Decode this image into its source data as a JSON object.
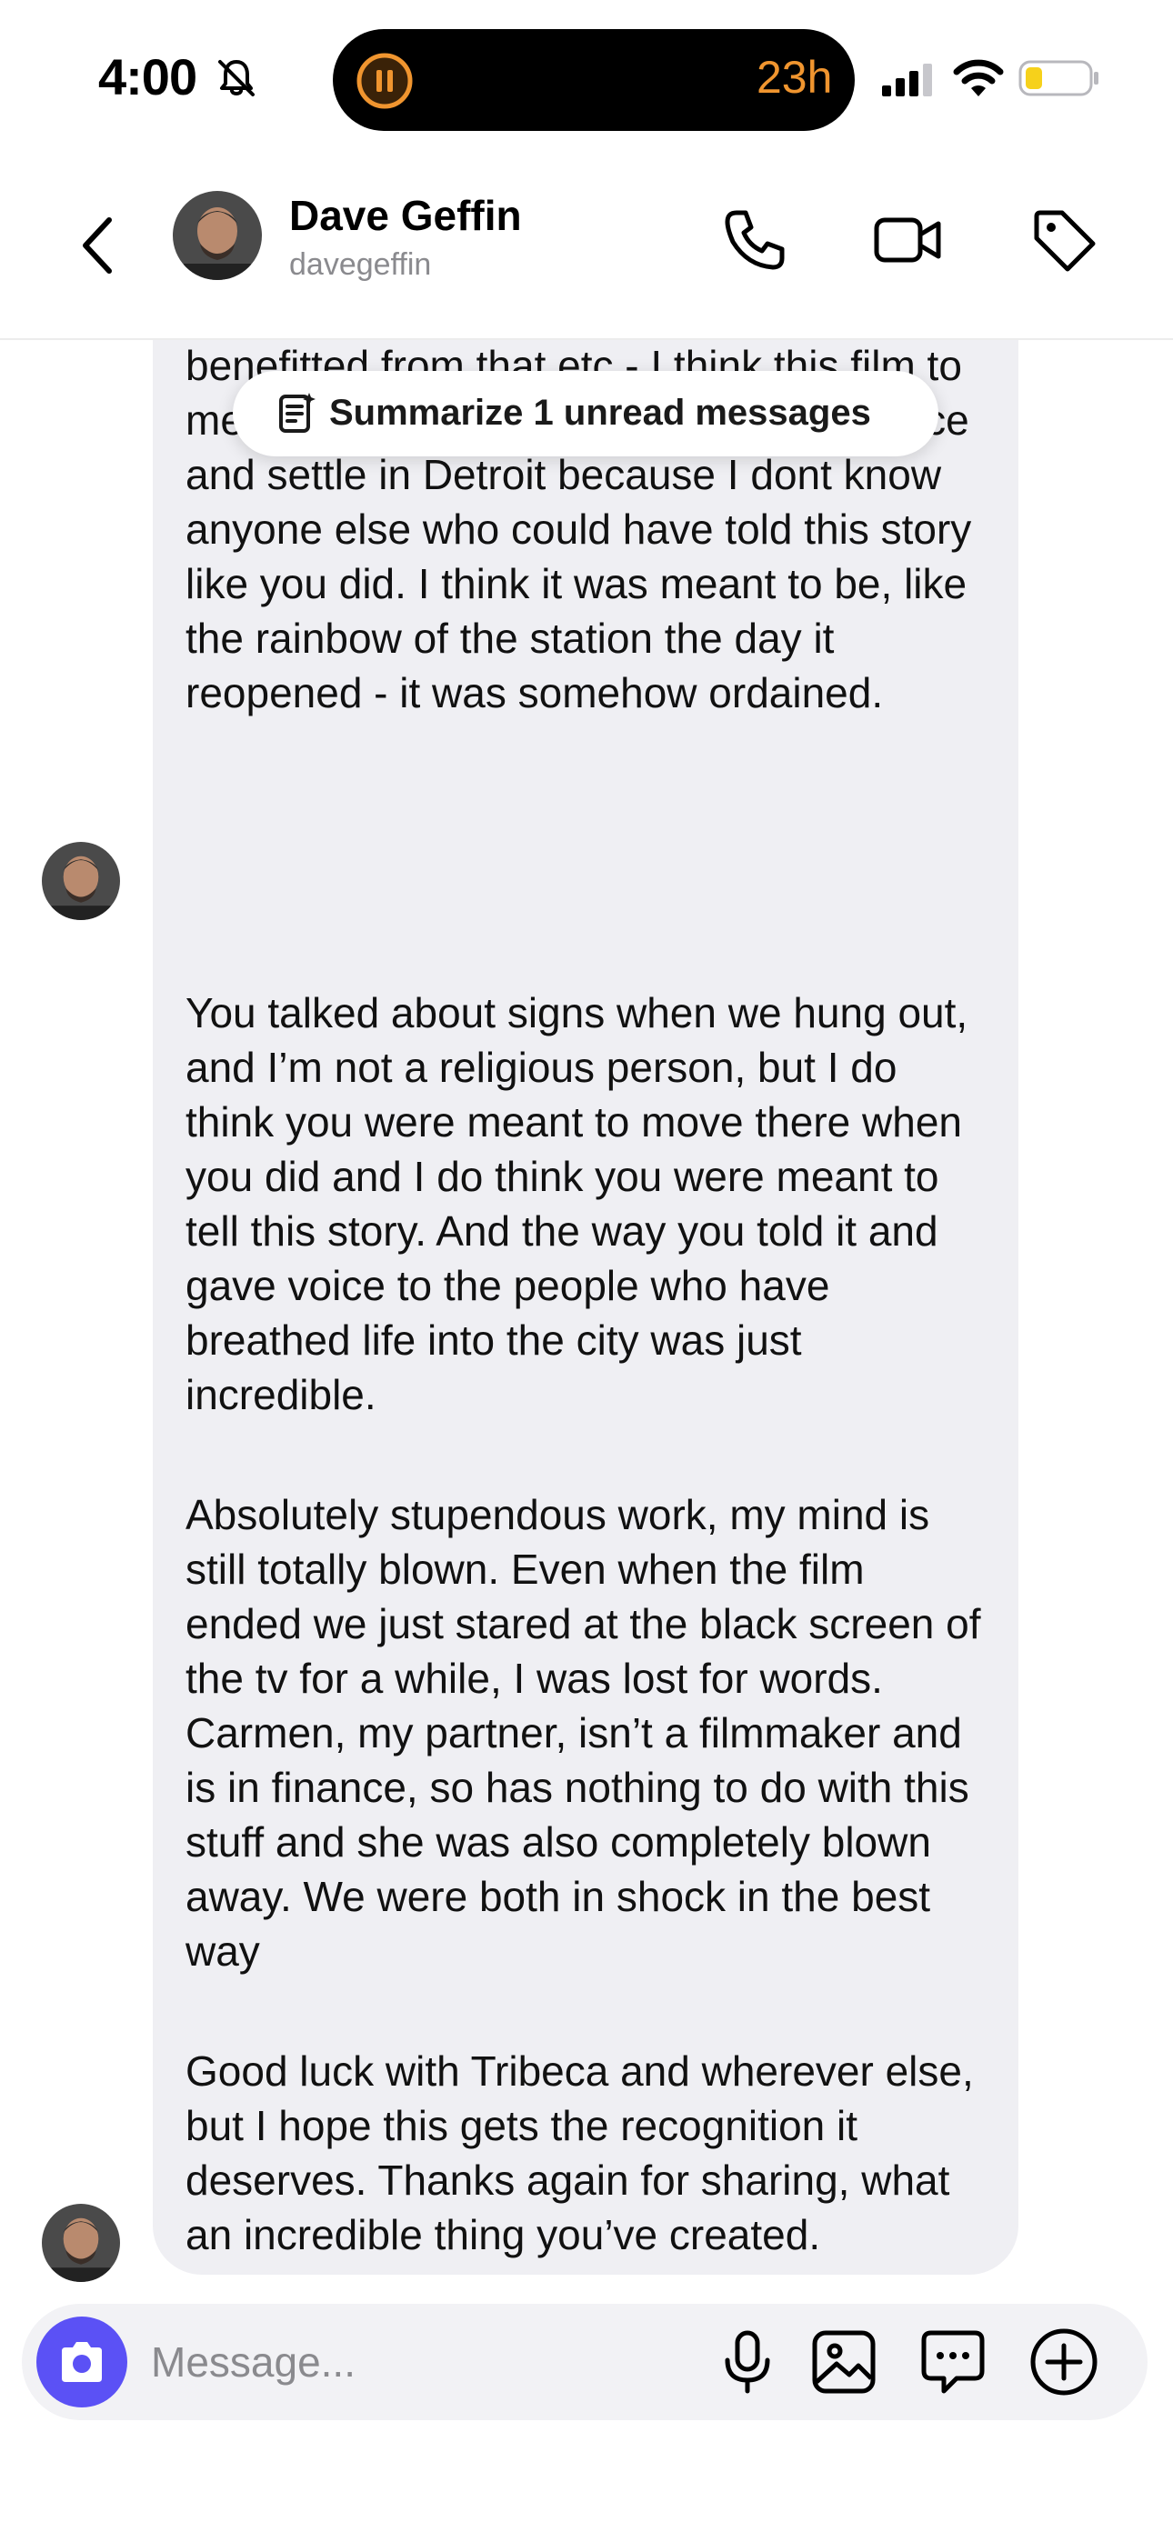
{
  "status_bar": {
    "time": "4:00",
    "island_timer": "23h"
  },
  "header": {
    "name": "Dave Geffin",
    "username": "davegeffin"
  },
  "summarize_pill": {
    "label": "Summarize 1 unread messages"
  },
  "messages": [
    {
      "paragraphs": [
        "benefitted from that etc - I think this film to me says you were meant to buy that place and settle in Detroit because I dont know anyone else who could have told this story like you did. I think it was meant to be, like the rainbow of the station the day it reopened - it was somehow ordained."
      ]
    },
    {
      "paragraphs": [
        "You talked about signs when we hung out, and I’m not a religious person, but I do think you were meant to move there when you did and I do think you were meant to tell this story. And the way you told it and gave voice to the people who have breathed life into the city was just incredible.",
        "Absolutely stupendous work, my mind is still totally blown. Even when the film ended we just stared at the black screen of the tv for a while, I was lost for words. Carmen, my partner, isn’t a filmmaker and is in finance, so has nothing to do with this stuff and she was also completely blown away. We were both in shock in the best way",
        "Good luck with Tribeca and wherever else, but I hope this gets the recognition it deserves. Thanks again for sharing, what an incredible thing you’ve created."
      ]
    }
  ],
  "composer": {
    "placeholder": "Message..."
  },
  "colors": {
    "accent": "#5b51f5",
    "bubble": "#efeff3",
    "island_orange": "#f0952f",
    "battery_yellow": "#f6d11b"
  },
  "icons": [
    "bell-slash-icon",
    "pause-icon",
    "signal-icon",
    "wifi-icon",
    "battery-icon",
    "back-chevron-icon",
    "phone-icon",
    "video-camera-icon",
    "tag-icon",
    "summary-icon",
    "camera-icon",
    "microphone-icon",
    "gallery-icon",
    "sticker-icon",
    "plus-icon"
  ]
}
